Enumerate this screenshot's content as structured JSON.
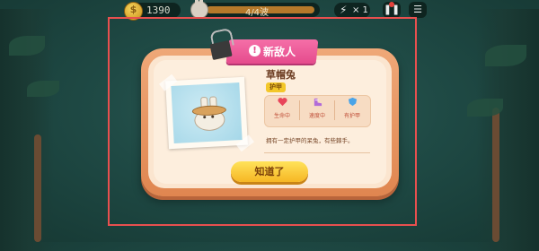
{
  "hud": {
    "coins": "1390",
    "wave": "4/4波",
    "wave_progress": 1.0,
    "speed": "× 1",
    "pause_icon": "pause-icon",
    "menu_icon": "list-icon"
  },
  "dialog": {
    "banner_title": "新敌人",
    "banner_icon": "!",
    "enemy_name": "草帽兔",
    "tag": "护甲",
    "stats": [
      {
        "icon": "heart-icon",
        "label": "生命中",
        "color": "#e8455a"
      },
      {
        "icon": "boot-icon",
        "label": "速度中",
        "color": "#b26bd8"
      },
      {
        "icon": "shield-icon",
        "label": "有护甲",
        "color": "#4aa4e8"
      }
    ],
    "description": "拥有一定护甲的呆兔，有些棘手。",
    "confirm_button": "知道了"
  },
  "colors": {
    "highlight_frame": "#e8504f",
    "banner": "#e54b8c",
    "button": "#f6b624"
  }
}
